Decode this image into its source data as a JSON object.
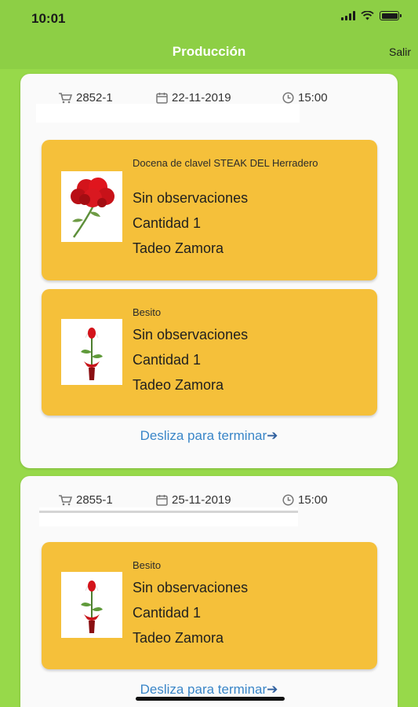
{
  "status_bar": {
    "time": "10:01"
  },
  "nav": {
    "title": "Producción",
    "action_label": "Salir"
  },
  "icons": {
    "cart": "cart-icon",
    "calendar": "calendar-icon",
    "clock": "clock-icon",
    "arrow": "arrow-right-icon"
  },
  "colors": {
    "background": "#97d94a",
    "card": "#f5c03a",
    "link": "#3a86c8"
  },
  "orders": [
    {
      "id": "2852-1",
      "date": "22-11-2019",
      "time": "15:00",
      "products": [
        {
          "name": "Docena de clavel STEAK DEL Herradero",
          "observations": "Sin observaciones",
          "quantity": "Cantidad 1",
          "person": "Tadeo Zamora",
          "image": "red-carnation-image"
        },
        {
          "name": "Besito",
          "observations": "Sin observaciones",
          "quantity": "Cantidad 1",
          "person": "Tadeo Zamora",
          "image": "single-rose-image"
        }
      ],
      "swipe_label": "Desliza para terminar"
    },
    {
      "id": "2855-1",
      "date": "25-11-2019",
      "time": "15:00",
      "products": [
        {
          "name": "Besito",
          "observations": "Sin observaciones",
          "quantity": "Cantidad 1",
          "person": "Tadeo Zamora",
          "image": "single-rose-image"
        }
      ],
      "swipe_label": "Desliza para terminar"
    }
  ]
}
